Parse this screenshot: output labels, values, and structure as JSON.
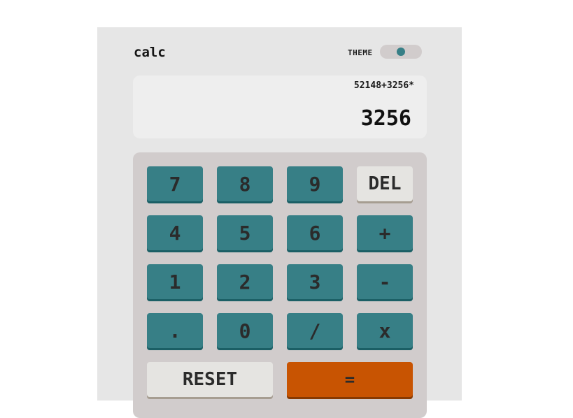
{
  "header": {
    "logo": "calc",
    "theme_label": "THEME"
  },
  "display": {
    "expression": "52148+3256*",
    "result": "3256"
  },
  "keys": {
    "row1": [
      "7",
      "8",
      "9",
      "DEL"
    ],
    "row2": [
      "4",
      "5",
      "6",
      "+"
    ],
    "row3": [
      "1",
      "2",
      "3",
      "-"
    ],
    "row4": [
      ".",
      "0",
      "/",
      "x"
    ],
    "reset": "RESET",
    "equals": "="
  },
  "colors": {
    "background": "#e6e6e6",
    "keypad": "#d1cccc",
    "number_key": "#377f86",
    "function_key": "#e5e4e1",
    "equals_key": "#c85402",
    "toggle_knob": "#377f86"
  }
}
